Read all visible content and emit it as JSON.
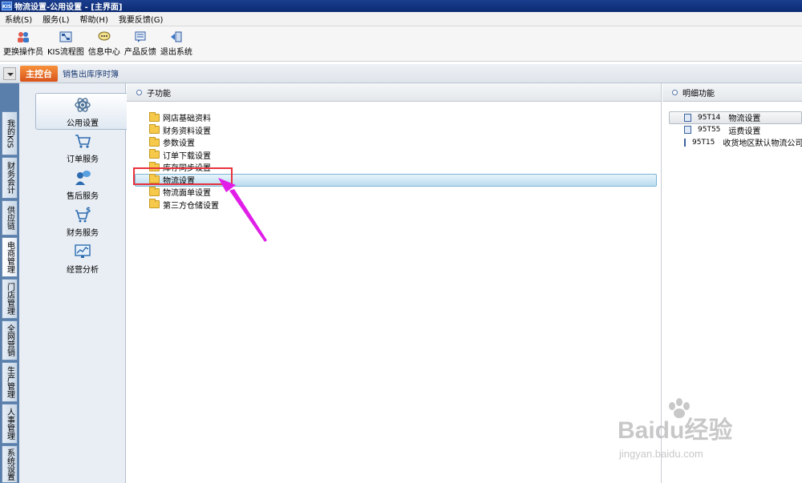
{
  "window": {
    "title": "物流设置-公用设置 - [主界面]",
    "logo_text": "KIS"
  },
  "menubar": {
    "items": [
      {
        "label": "系统(S)"
      },
      {
        "label": "服务(L)"
      },
      {
        "label": "帮助(H)"
      },
      {
        "label": "我要反馈(G)"
      }
    ]
  },
  "toolbar": {
    "items": [
      {
        "label": "更换操作员",
        "icon": "users-icon"
      },
      {
        "label": "KIS流程图",
        "icon": "flowchart-icon"
      },
      {
        "label": "信息中心",
        "icon": "message-icon"
      },
      {
        "label": "产品反馈",
        "icon": "feedback-icon"
      },
      {
        "label": "退出系统",
        "icon": "exit-icon"
      }
    ]
  },
  "nav": {
    "main_tab": "主控台",
    "sub_tab": "销售出库序时簿"
  },
  "left_tabs": [
    {
      "label": "我的KIS"
    },
    {
      "label": "财务会计"
    },
    {
      "label": "供应链"
    },
    {
      "label": "电商管理"
    },
    {
      "label": "门店管理"
    },
    {
      "label": "全网营销"
    },
    {
      "label": "生产管理"
    },
    {
      "label": "人事管理"
    },
    {
      "label": "系统设置"
    }
  ],
  "categories": [
    {
      "label": "公用设置",
      "icon": "atom-icon",
      "active": true
    },
    {
      "label": "订单服务",
      "icon": "cart-icon"
    },
    {
      "label": "售后服务",
      "icon": "support-icon"
    },
    {
      "label": "财务服务",
      "icon": "cart-dollar-icon"
    },
    {
      "label": "经营分析",
      "icon": "chart-monitor-icon"
    }
  ],
  "subfunctions": {
    "header": "子功能",
    "items": [
      {
        "label": "网店基础资料"
      },
      {
        "label": "财务资料设置"
      },
      {
        "label": "参数设置"
      },
      {
        "label": "订单下载设置"
      },
      {
        "label": "库存同步设置"
      },
      {
        "label": "物流设置",
        "selected": true
      },
      {
        "label": "物流面单设置"
      },
      {
        "label": "第三方仓储设置"
      }
    ]
  },
  "details": {
    "header": "明细功能",
    "items": [
      {
        "code": "95T14",
        "label": "物流设置",
        "selected": true
      },
      {
        "code": "95T55",
        "label": "运费设置"
      },
      {
        "code": "95T15",
        "label": "收货地区默认物流公司"
      }
    ]
  },
  "watermark": {
    "brand": "Baidu经验",
    "url": "jingyan.baidu.com"
  },
  "colors": {
    "highlight_box": "#e8323c",
    "arrow": "#e01ee8",
    "title_bar": "#0b2a72",
    "main_tab": "#e46a26"
  }
}
